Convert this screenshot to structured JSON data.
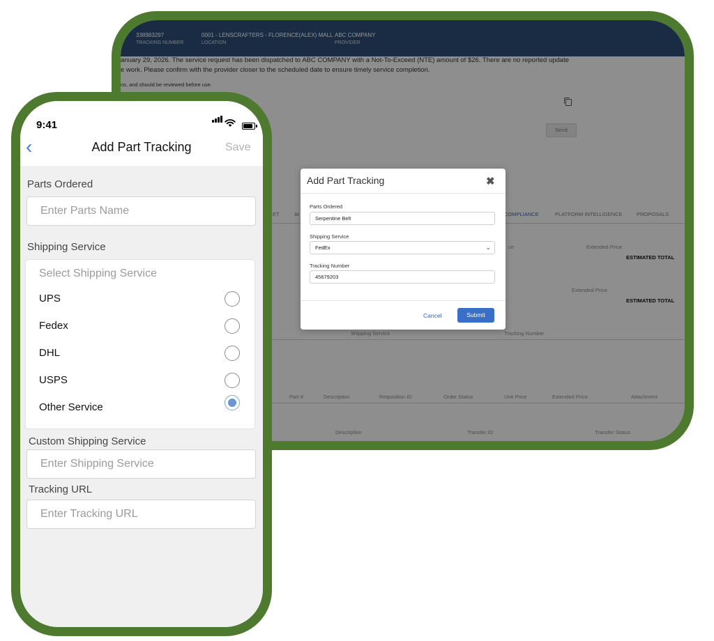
{
  "desktop": {
    "header": {
      "tracking_number": "338983297",
      "tracking_number_label": "TRACKING NUMBER",
      "location": "0001 - LENSCRAFTERS - FLORENCE(ALEX) MALL",
      "location_label": "LOCATION",
      "provider": "ABC COMPANY",
      "provider_label": "PROVIDER"
    },
    "notice_line1": "anuary 29, 2026. The service request has been dispatched to ABC COMPANY with a Not-To-Exceed (NTE) amount of $26. There are no reported update",
    "notice_line2": "e work. Please confirm with the provider closer to the scheduled date to ensure timely service completion.",
    "notice_small": "ns, and should be reviewed before use.",
    "send_label": "Send",
    "tabs": [
      "ET",
      "AI",
      "COMPLIANCE",
      "PLATFORM INTELLIGENCE",
      "PROPOSALS"
    ],
    "extended_price": "Extended Price",
    "price_partial": "ce",
    "estimated_total": "ESTIMATED TOTAL",
    "shipping_service_label": "Shipping Service",
    "tracking_number_col": "Tracking Number",
    "parts_table_headers": [
      "Part #",
      "Description",
      "Requisition ID",
      "Order Status",
      "Unit Price",
      "Extended Price",
      "Attachment"
    ],
    "transfer_headers": [
      "Description",
      "Transfer ID",
      "Transfer Status"
    ]
  },
  "modal": {
    "title": "Add Part Tracking",
    "close_glyph": "✖",
    "parts_label": "Parts Ordered",
    "parts_value": "Serpentine Belt",
    "shipping_label": "Shipping Service",
    "shipping_value": "FedEx",
    "tracking_label": "Tracking Number",
    "tracking_value": "45679203",
    "cancel": "Cancel",
    "submit": "Submit"
  },
  "phone": {
    "time": "9:41",
    "back_glyph": "‹",
    "title": "Add Part Tracking",
    "save": "Save",
    "parts_label": "Parts Ordered",
    "parts_placeholder": "Enter Parts Name",
    "shipping_label": "Shipping Service",
    "shipping_placeholder": "Select Shipping Service",
    "options": [
      {
        "label": "UPS",
        "selected": false
      },
      {
        "label": "Fedex",
        "selected": false
      },
      {
        "label": "DHL",
        "selected": false
      },
      {
        "label": "USPS",
        "selected": false
      },
      {
        "label": "Other Service",
        "selected": true
      }
    ],
    "custom_label": "Custom Shipping Service",
    "custom_placeholder": "Enter Shipping Service",
    "url_label": "Tracking URL",
    "url_placeholder": "Enter Tracking URL"
  },
  "colors": {
    "frame_green": "#4d7a2e",
    "header_navy": "#2c4d74",
    "accent_blue": "#3a6fc7",
    "ios_blue": "#3b82d6"
  }
}
